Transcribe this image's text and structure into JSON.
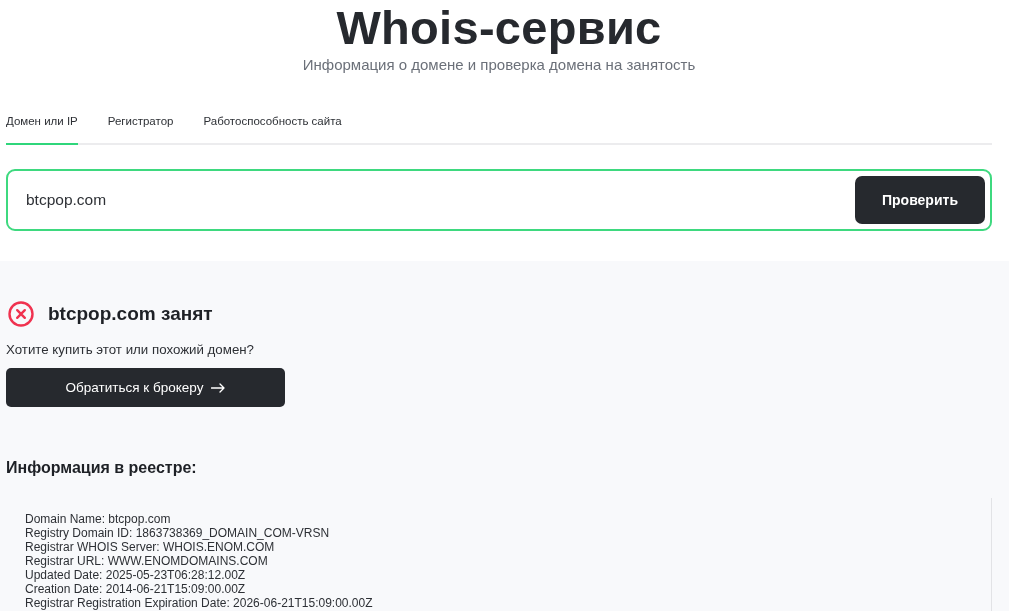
{
  "header": {
    "title": "Whois-сервис",
    "subtitle": "Информация о домене и проверка домена на занятость"
  },
  "tabs": [
    {
      "label": "Домен или IP",
      "selected": true
    },
    {
      "label": "Регистратор",
      "selected": false
    },
    {
      "label": "Работоспособность сайта",
      "selected": false
    }
  ],
  "search": {
    "value": "btcpop.com",
    "button": "Проверить"
  },
  "result": {
    "taken": true,
    "title": "btcpop.com занят",
    "question": "Хотите купить этот или похожий домен?",
    "broker_button": "Обратиться к брокеру"
  },
  "registry": {
    "title": "Информация в реестре:",
    "lines": [
      "Domain Name: btcpop.com",
      "Registry Domain ID: 1863738369_DOMAIN_COM-VRSN",
      "Registrar WHOIS Server: WHOIS.ENOM.COM",
      "Registrar URL: WWW.ENOMDOMAINS.COM",
      "Updated Date: 2025-05-23T06:28:12.00Z",
      "Creation Date: 2014-06-21T15:09:00.00Z",
      "Registrar Registration Expiration Date: 2026-06-21T15:09:00.00Z"
    ]
  }
}
